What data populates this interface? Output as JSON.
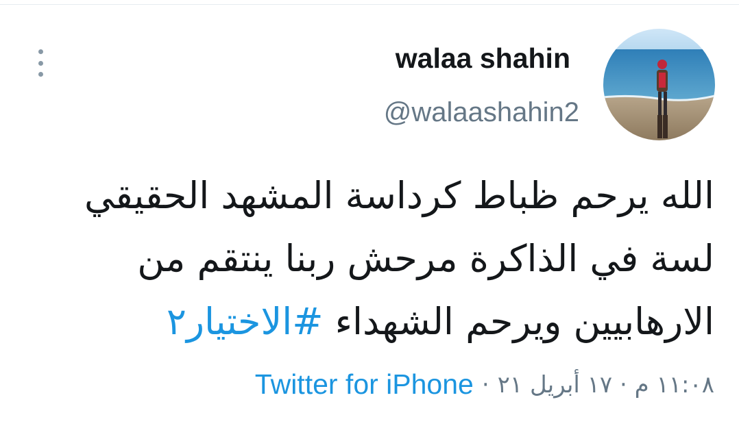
{
  "author": {
    "display_name": "walaa shahin",
    "handle": "@walaashahin2"
  },
  "tweet": {
    "text_before_hashtag": "الله يرحم ظباط كرداسة المشهد الحقيقي لسة في الذاكرة مرحش ربنا ينتقم من الارهابيين ويرحم الشهداء ",
    "hashtag": "#الاختيار٢"
  },
  "meta": {
    "timestamp": "١١:٠٨ م · ١٧ أبريل ٢١",
    "separator": "·",
    "source": "Twitter for iPhone"
  },
  "icons": {
    "more": "vertical-ellipsis-icon"
  },
  "colors": {
    "text": "#14171a",
    "secondary": "#657786",
    "link": "#1b95e0",
    "icon": "#8899a6"
  }
}
